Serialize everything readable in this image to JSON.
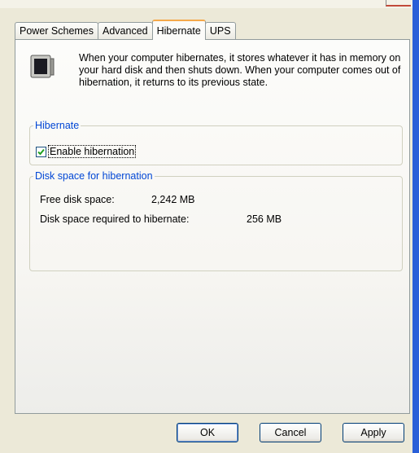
{
  "tabs": [
    {
      "label": "Power Schemes",
      "active": false
    },
    {
      "label": "Advanced",
      "active": false
    },
    {
      "label": "Hibernate",
      "active": true
    },
    {
      "label": "UPS",
      "active": false
    }
  ],
  "description": "When your computer hibernates, it stores whatever it has in memory on your hard disk and then shuts down. When your computer comes out of hibernation, it returns to its previous state.",
  "hibernate_group": {
    "legend": "Hibernate",
    "enable_label": "Enable hibernation",
    "enabled": true
  },
  "disk_group": {
    "legend": "Disk space for hibernation",
    "free_label": "Free disk space:",
    "free_value": "2,242 MB",
    "required_label": "Disk space required to hibernate:",
    "required_value": "256 MB"
  },
  "buttons": {
    "ok": "OK",
    "cancel": "Cancel",
    "apply": "Apply"
  },
  "colors": {
    "legend": "#0046d5",
    "tab_highlight": "#f5a94a",
    "window_border": "#2a5fd8"
  },
  "icons": {
    "hibernate": "hibernate-monitor-icon",
    "check": "checkmark-icon"
  }
}
